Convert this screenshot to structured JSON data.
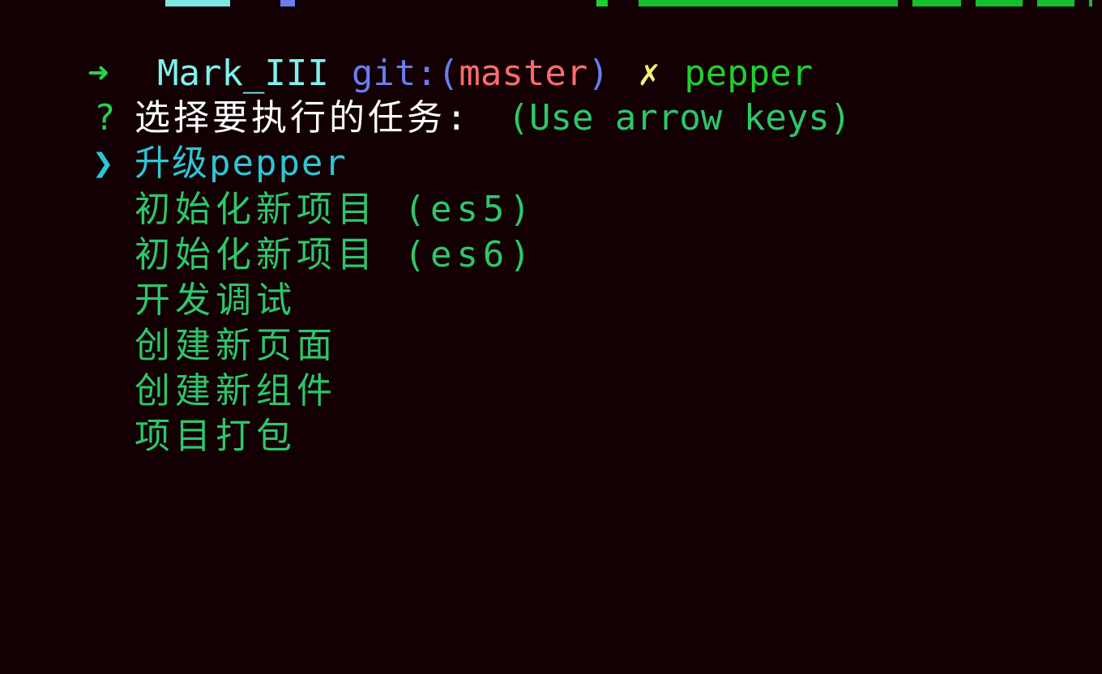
{
  "colors": {
    "background": "#120003",
    "prompt_arrow": "#27d34a",
    "directory": "#7ff1ef",
    "git_label": "#6a7df0",
    "branch": "#ff6a6a",
    "dirty_marker": "#f3ec76",
    "command": "#1fd02e",
    "question_text": "#ffffff",
    "hint_text": "#2dc76a",
    "selected_choice": "#2ec6d4",
    "choice": "#2dc76a"
  },
  "prompt": {
    "arrow": "➜",
    "directory": "Mark_III",
    "git_label": "git:",
    "paren_open": "(",
    "branch": "master",
    "paren_close": ")",
    "dirty_marker": "✗",
    "command": "pepper"
  },
  "question": {
    "marker": "?",
    "text": "选择要执行的任务:",
    "hint": "(Use arrow keys)"
  },
  "menu": {
    "pointer": "❯",
    "selected": "升级pepper",
    "items": [
      "初始化新项目 (es5)",
      "初始化新项目 (es6)",
      "开发调试",
      "创建新页面",
      "创建新组件",
      "项目打包"
    ]
  }
}
